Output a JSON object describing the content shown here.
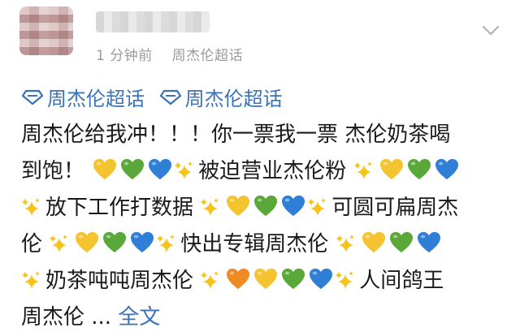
{
  "post": {
    "time": "1 分钟前",
    "source": "周杰伦超话",
    "topics": [
      "周杰伦超话",
      "周杰伦超话"
    ],
    "lines": [
      {
        "segments": [
          {
            "t": "text",
            "v": "周杰伦给我冲！！！你一票我一票 杰伦奶茶喝"
          }
        ]
      },
      {
        "segments": [
          {
            "t": "text",
            "v": "到饱！ "
          },
          {
            "t": "heart",
            "c": "#f4c430"
          },
          {
            "t": "heart",
            "c": "#5aa83a"
          },
          {
            "t": "heart",
            "c": "#2f7fd6"
          },
          {
            "t": "sparkle"
          },
          {
            "t": "text",
            "v": "被迫营业杰伦粉 "
          },
          {
            "t": "sparkle"
          },
          {
            "t": "heart",
            "c": "#f4c430"
          },
          {
            "t": "heart",
            "c": "#5aa83a"
          },
          {
            "t": "heart",
            "c": "#2f7fd6"
          }
        ]
      },
      {
        "segments": [
          {
            "t": "sparkle"
          },
          {
            "t": "text",
            "v": "放下工作打数据 "
          },
          {
            "t": "sparkle"
          },
          {
            "t": "heart",
            "c": "#f4c430"
          },
          {
            "t": "heart",
            "c": "#5aa83a"
          },
          {
            "t": "heart",
            "c": "#2f7fd6"
          },
          {
            "t": "sparkle"
          },
          {
            "t": "text",
            "v": "可圆可扁周杰"
          }
        ]
      },
      {
        "segments": [
          {
            "t": "text",
            "v": "伦 "
          },
          {
            "t": "sparkle"
          },
          {
            "t": "heart",
            "c": "#f4c430"
          },
          {
            "t": "heart",
            "c": "#5aa83a"
          },
          {
            "t": "heart",
            "c": "#2f7fd6"
          },
          {
            "t": "sparkle"
          },
          {
            "t": "text",
            "v": "快出专辑周杰伦 "
          },
          {
            "t": "sparkle"
          },
          {
            "t": "heart",
            "c": "#f4c430"
          },
          {
            "t": "heart",
            "c": "#5aa83a"
          },
          {
            "t": "heart",
            "c": "#2f7fd6"
          }
        ]
      },
      {
        "segments": [
          {
            "t": "sparkle"
          },
          {
            "t": "text",
            "v": "奶茶吨吨周杰伦 "
          },
          {
            "t": "sparkle"
          },
          {
            "t": "heart",
            "c": "#f08a24"
          },
          {
            "t": "heart",
            "c": "#f4c430"
          },
          {
            "t": "heart",
            "c": "#5aa83a"
          },
          {
            "t": "heart",
            "c": "#2f7fd6"
          },
          {
            "t": "sparkle"
          },
          {
            "t": "text",
            "v": "人间鸽王"
          }
        ]
      },
      {
        "segments": [
          {
            "t": "text",
            "v": "周杰伦 ... "
          },
          {
            "t": "more",
            "v": "全文"
          }
        ]
      }
    ]
  },
  "colors": {
    "link": "#3a72b8",
    "meta": "#9a9a9a",
    "sparkle": "#f6c31c"
  }
}
